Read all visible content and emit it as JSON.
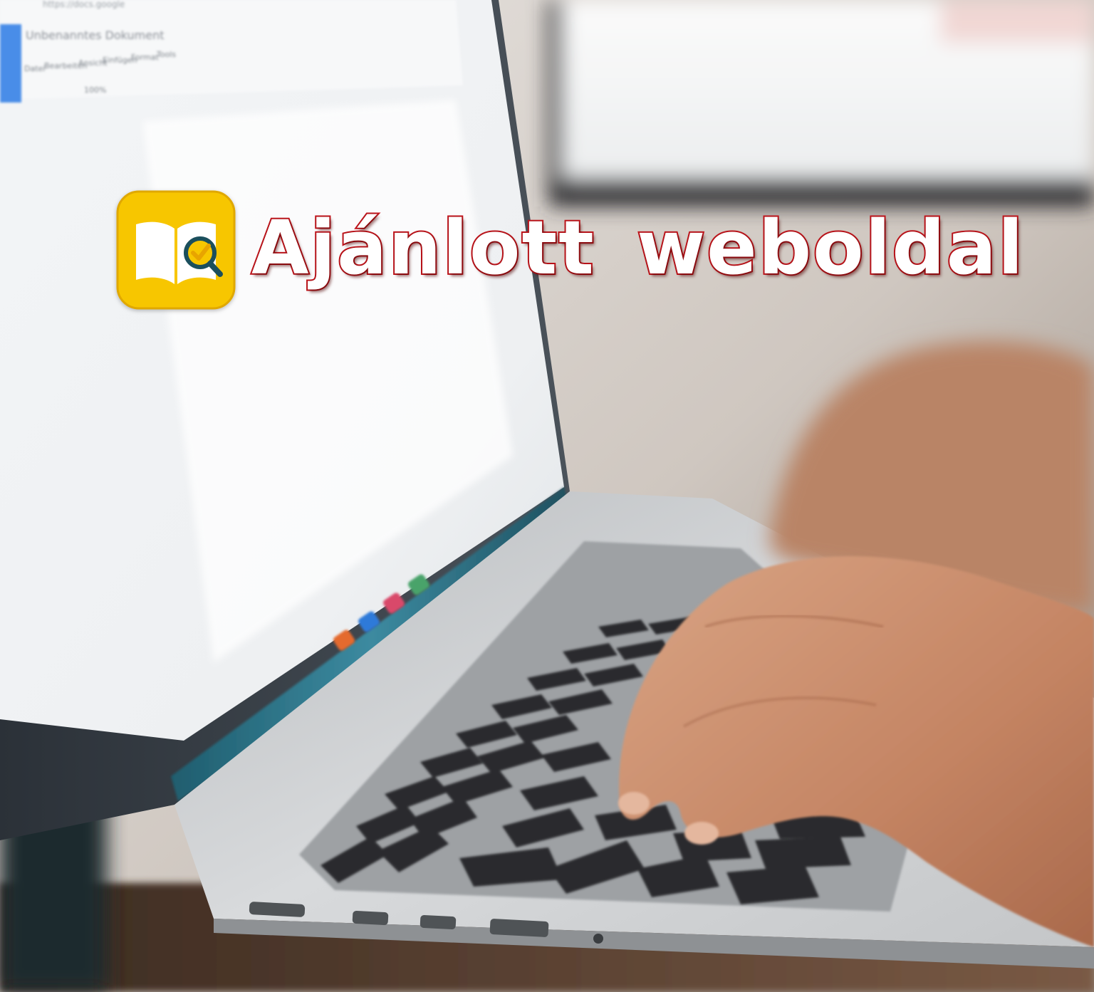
{
  "banner": {
    "title": "Ajánlott weboldal",
    "icon": "book-magnifier-app-icon",
    "icon_background": "#f7c600",
    "title_fill_color": "#ffffff",
    "title_outline_color": "#c4151c"
  },
  "photo": {
    "screen_doc_title": "Unbenanntes Dokument",
    "screen_url": "https://docs.google",
    "screen_menu": [
      "Datei",
      "Bearbeiten",
      "Ansicht",
      "Einfügen",
      "Format",
      "Tools"
    ],
    "screen_zoom": "100%"
  }
}
